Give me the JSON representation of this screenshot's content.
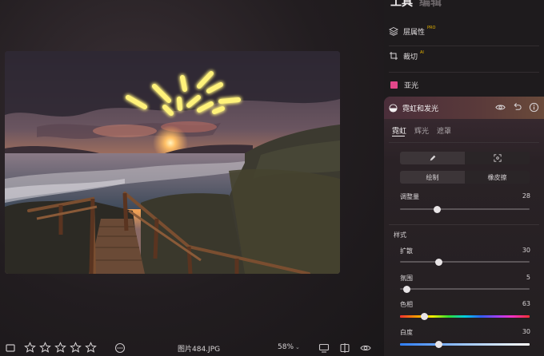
{
  "panel": {
    "tabs": [
      {
        "label": "工具",
        "active": true
      },
      {
        "label": "编辑",
        "active": false
      }
    ],
    "rows": {
      "layer_props": {
        "label": "层属性",
        "badge": "PRO"
      },
      "crop": {
        "label": "裁切",
        "badge": "AI"
      },
      "matte": {
        "label": "亚光",
        "swatch_color": "#e2478a"
      }
    },
    "glow": {
      "title": "霓虹和发光",
      "sub_tabs": [
        "霓虹",
        "辉光",
        "遮罩"
      ],
      "active_sub_tab": 0,
      "mode_buttons": {
        "draw": "绘制",
        "eraser": "橡皮擦"
      },
      "adjust": {
        "label": "调整量",
        "value": "28",
        "fraction": 0.28
      },
      "style_section": "样式",
      "sliders": [
        {
          "label": "扩散",
          "value": "30",
          "fraction": 0.3
        },
        {
          "label": "氛围",
          "value": "5",
          "fraction": 0.05
        },
        {
          "label": "色相",
          "value": "63",
          "fraction": 0.19
        },
        {
          "label": "白度",
          "value": "30",
          "fraction": 0.3
        }
      ]
    }
  },
  "bottom": {
    "filename": "图片484.JPG",
    "zoom": "58%",
    "rating_stars": 5
  },
  "colors": {
    "accent_pink": "#e2478a",
    "neon_yellow": "#fff27a"
  }
}
